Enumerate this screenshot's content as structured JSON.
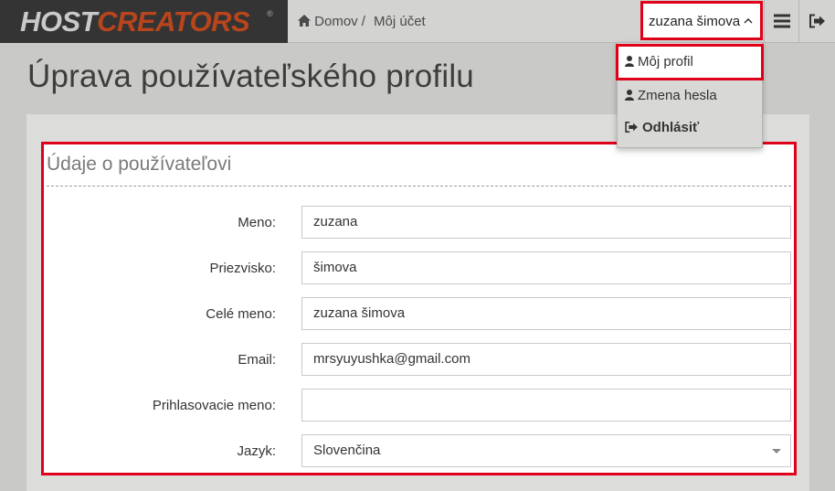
{
  "header": {
    "logo_host": "HOST",
    "logo_creators": "CREATORS",
    "logo_reg": "®",
    "breadcrumb": {
      "home": "Domov",
      "separator": "/",
      "current": "Môj účet"
    },
    "user_name": "zuzana šimova",
    "icons": {
      "home": "home-icon",
      "caret": "chevron-up-icon",
      "menu": "hamburger-menu-icon",
      "logout": "logout-icon"
    }
  },
  "page": {
    "title": "Úprava používateľského profilu"
  },
  "form": {
    "legend": "Údaje o používateľovi",
    "fields": [
      {
        "label": "Meno:",
        "value": "zuzana"
      },
      {
        "label": "Priezvisko:",
        "value": "šimova"
      },
      {
        "label": "Celé meno:",
        "value": "zuzana šimova"
      },
      {
        "label": "Email:",
        "value": "mrsyuyushka@gmail.com"
      },
      {
        "label": "Prihlasovacie meno:",
        "value": ""
      },
      {
        "label": "Jazyk:",
        "value": "Slovenčina"
      }
    ]
  },
  "dropdown": {
    "items": [
      {
        "label": "Môj profil",
        "icon": "user-icon"
      },
      {
        "label": "Zmena hesla",
        "icon": "user-icon"
      },
      {
        "label": "Odhlásiť",
        "icon": "logout-icon"
      }
    ]
  },
  "colors": {
    "highlight": "#e0001a",
    "logo_accent": "#b8451c",
    "logo_bg": "#343434"
  }
}
